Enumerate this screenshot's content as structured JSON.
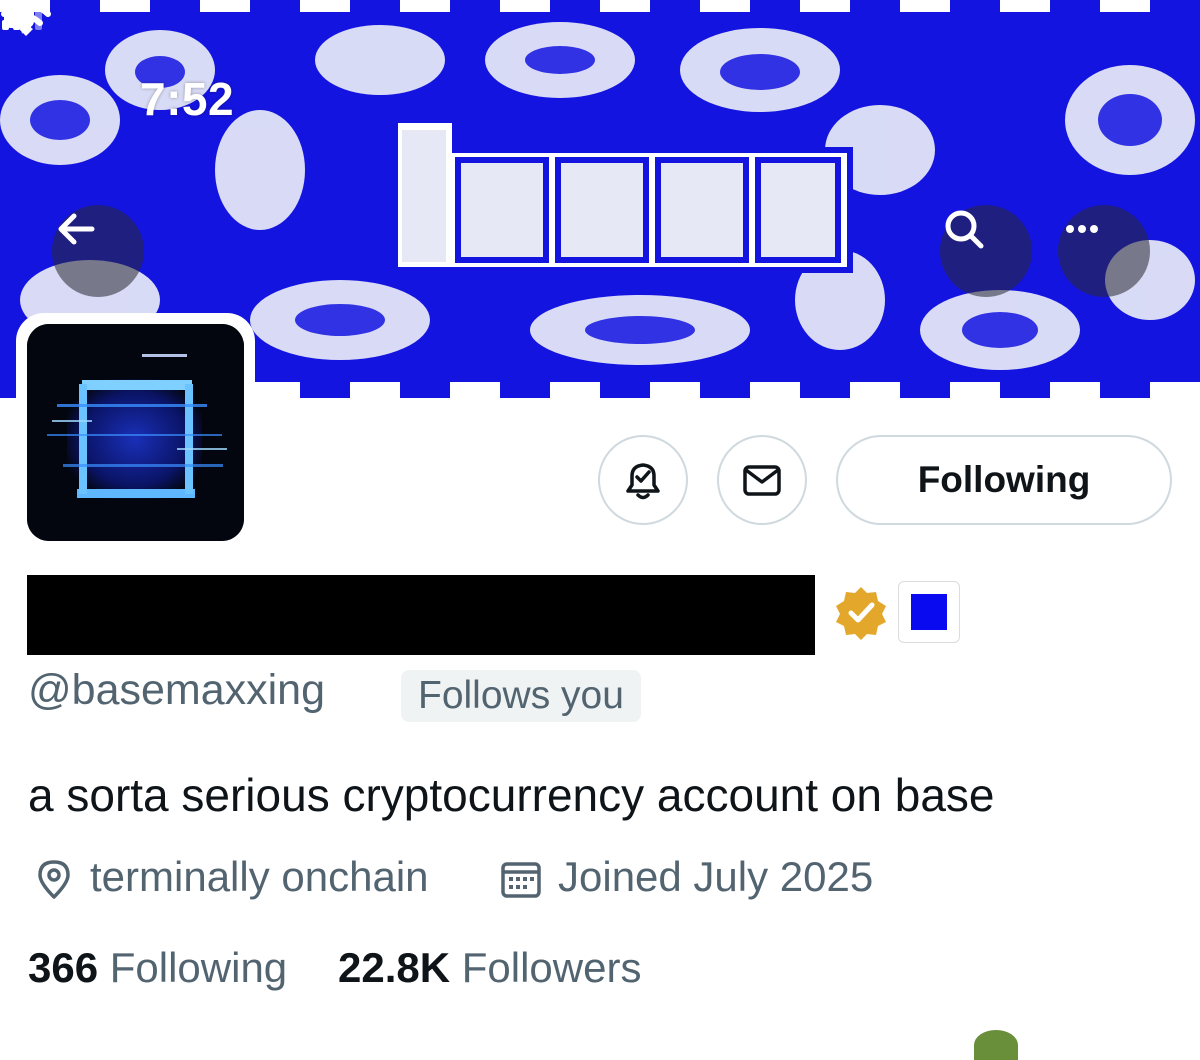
{
  "status_bar": {
    "time": "7:52",
    "icons": [
      "location-arrow-icon",
      "signal-icon",
      "wifi-icon",
      "battery-icon"
    ]
  },
  "header": {
    "back_icon": "arrow-left-icon",
    "search_icon": "search-icon",
    "more_icon": "more-horizontal-icon"
  },
  "colors": {
    "banner_blue": "#1414e0",
    "badge_gold": "#e3a82b",
    "badge_square": "#0a0af0",
    "secondary_text": "#536471",
    "primary_text": "#0f1419"
  },
  "profile": {
    "handle": "@basemaxxing",
    "follows_you": "Follows you",
    "bio": "a sorta serious cryptocurrency account on base",
    "location": "terminally onchain",
    "joined": "Joined July 2025",
    "following_count": "366",
    "following_label": "Following",
    "followers_count": "22.8K",
    "followers_label": "Followers"
  },
  "actions": {
    "notify_icon": "bell-check-icon",
    "message_icon": "envelope-icon",
    "follow_button": "Following"
  }
}
